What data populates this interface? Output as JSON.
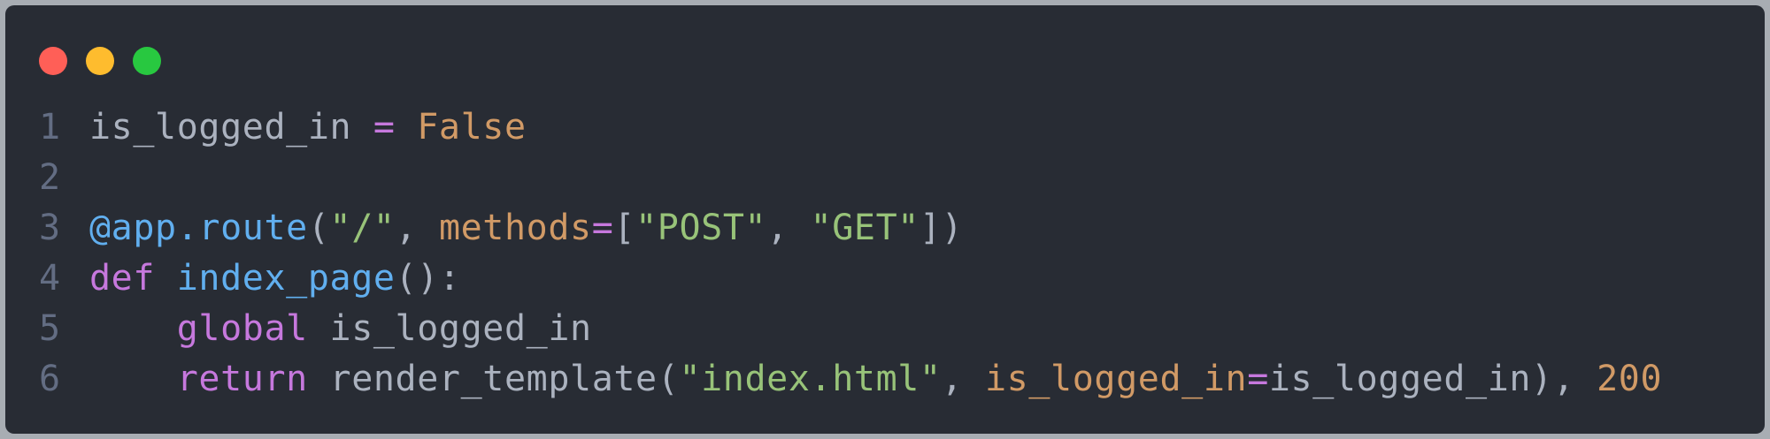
{
  "window": {
    "controls": [
      "close",
      "minimize",
      "zoom"
    ],
    "colors": {
      "close": "#ff5f57",
      "minimize": "#febc2e",
      "zoom": "#28c840",
      "background": "#282c34"
    }
  },
  "code": {
    "language": "python",
    "lines": [
      {
        "number": "1",
        "tokens": [
          {
            "t": "is_logged_in ",
            "c": "plain"
          },
          {
            "t": "=",
            "c": "op"
          },
          {
            "t": " ",
            "c": "plain"
          },
          {
            "t": "False",
            "c": "num"
          }
        ]
      },
      {
        "number": "2",
        "tokens": []
      },
      {
        "number": "3",
        "tokens": [
          {
            "t": "@app.route",
            "c": "fn"
          },
          {
            "t": "(",
            "c": "plain"
          },
          {
            "t": "\"/\"",
            "c": "str"
          },
          {
            "t": ", ",
            "c": "plain"
          },
          {
            "t": "methods",
            "c": "param"
          },
          {
            "t": "=",
            "c": "op"
          },
          {
            "t": "[",
            "c": "plain"
          },
          {
            "t": "\"POST\"",
            "c": "str"
          },
          {
            "t": ", ",
            "c": "plain"
          },
          {
            "t": "\"GET\"",
            "c": "str"
          },
          {
            "t": "])",
            "c": "plain"
          }
        ]
      },
      {
        "number": "4",
        "tokens": [
          {
            "t": "def",
            "c": "kw"
          },
          {
            "t": " ",
            "c": "plain"
          },
          {
            "t": "index_page",
            "c": "fn"
          },
          {
            "t": "():",
            "c": "plain"
          }
        ]
      },
      {
        "number": "5",
        "tokens": [
          {
            "t": "    ",
            "c": "plain"
          },
          {
            "t": "global",
            "c": "kw"
          },
          {
            "t": " is_logged_in",
            "c": "plain"
          }
        ]
      },
      {
        "number": "6",
        "tokens": [
          {
            "t": "    ",
            "c": "plain"
          },
          {
            "t": "return",
            "c": "kw"
          },
          {
            "t": " render_template(",
            "c": "plain"
          },
          {
            "t": "\"index.html\"",
            "c": "str"
          },
          {
            "t": ", ",
            "c": "plain"
          },
          {
            "t": "is_logged_in",
            "c": "param"
          },
          {
            "t": "=",
            "c": "op"
          },
          {
            "t": "is_logged_in), ",
            "c": "plain"
          },
          {
            "t": "200",
            "c": "num"
          }
        ]
      }
    ]
  }
}
